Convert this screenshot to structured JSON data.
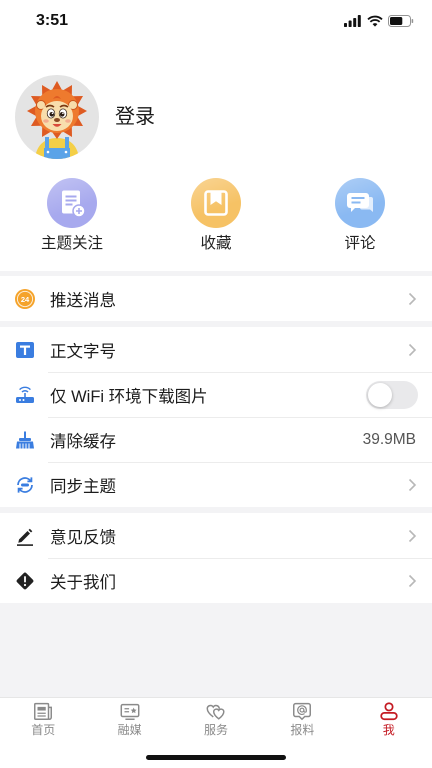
{
  "status_bar": {
    "time": "3:51",
    "icons": [
      "cellular-signal-icon",
      "wifi-icon",
      "battery-icon"
    ],
    "battery_level": 0.65
  },
  "profile": {
    "avatar": "lion-mascot-avatar",
    "login_label": "登录"
  },
  "quick_actions": [
    {
      "label": "主题关注",
      "icon": "topic-follow-icon",
      "color": "#a7a9ee"
    },
    {
      "label": "收藏",
      "icon": "favorites-icon",
      "color": "#f6c265"
    },
    {
      "label": "评论",
      "icon": "comment-icon",
      "color": "#8ab9f2"
    }
  ],
  "settings": {
    "push_messages": {
      "label": "推送消息",
      "icon": "push-notification-icon",
      "icon_text": "24"
    },
    "font_size": {
      "label": "正文字号",
      "icon": "font-size-icon"
    },
    "wifi_only_images": {
      "label": "仅 WiFi 环境下载图片",
      "icon": "wifi-router-icon",
      "enabled": false
    },
    "clear_cache": {
      "label": "清除缓存",
      "icon": "broom-icon",
      "value": "39.9MB"
    },
    "sync_topics": {
      "label": "同步主题",
      "icon": "sync-icon"
    },
    "feedback": {
      "label": "意见反馈",
      "icon": "edit-pencil-icon"
    },
    "about_us": {
      "label": "关于我们",
      "icon": "info-diamond-icon"
    }
  },
  "tab_bar": {
    "tabs": [
      {
        "label": "首页",
        "icon": "newspaper-icon",
        "active": false
      },
      {
        "label": "融媒",
        "icon": "media-tv-icon",
        "active": false
      },
      {
        "label": "服务",
        "icon": "service-hearts-icon",
        "active": false
      },
      {
        "label": "报料",
        "icon": "news-tip-chat-icon",
        "active": false
      },
      {
        "label": "我",
        "icon": "profile-person-icon",
        "active": true
      }
    ]
  },
  "colors": {
    "accent": "#c41a22",
    "icon_blue": "#3a7de0",
    "push_badge": "#f5a32a",
    "dark_icon": "#222222",
    "inactive_tab": "#8a8a8a",
    "background": "#f3f3f5"
  }
}
